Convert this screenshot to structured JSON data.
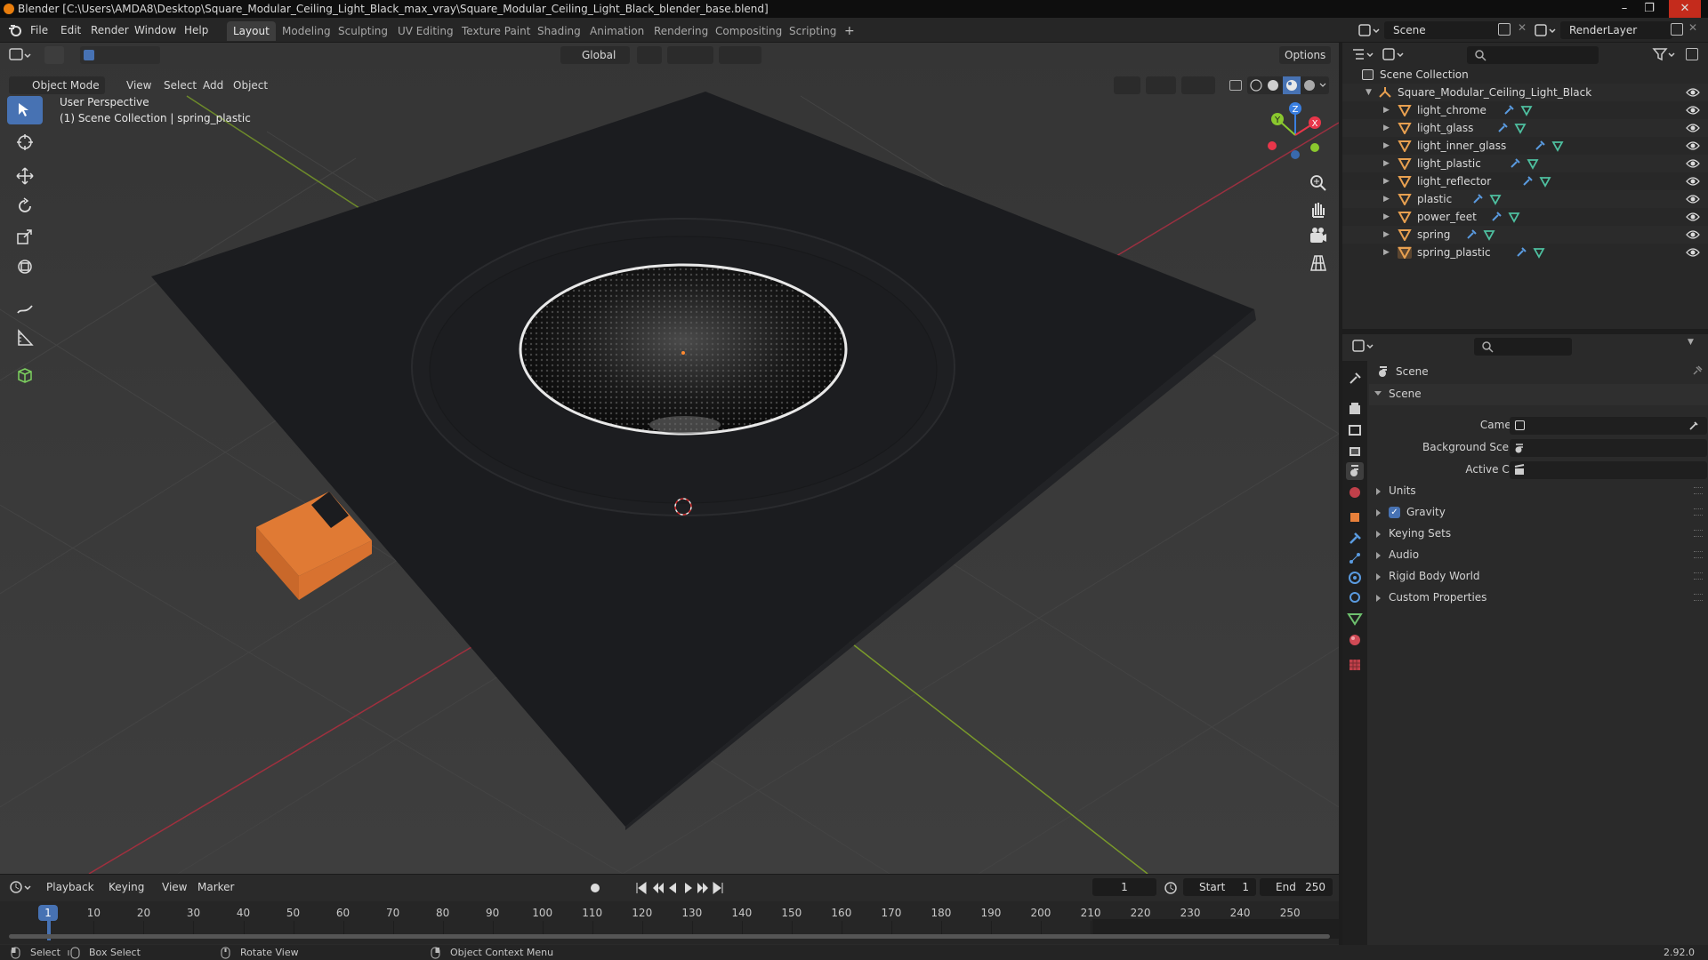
{
  "window": {
    "title": "Blender [C:\\Users\\AMDA8\\Desktop\\Square_Modular_Ceiling_Light_Black_max_vray\\Square_Modular_Ceiling_Light_Black_blender_base.blend]",
    "minimize": "–",
    "maximize": "❐",
    "close": "✕"
  },
  "menu": {
    "file": "File",
    "edit": "Edit",
    "render": "Render",
    "window": "Window",
    "help": "Help"
  },
  "workspaces": [
    "Layout",
    "Modeling",
    "Sculpting",
    "UV Editing",
    "Texture Paint",
    "Shading",
    "Animation",
    "Rendering",
    "Compositing",
    "Scripting"
  ],
  "add_workspace": "+",
  "scene_field": "Scene",
  "render_layer_field": "RenderLayer",
  "viewport": {
    "mode": "Object Mode",
    "menus": {
      "view": "View",
      "select": "Select",
      "add": "Add",
      "object": "Object"
    },
    "orientation": "Global",
    "options": "Options",
    "overlay_line1": "User Perspective",
    "overlay_line2": "(1) Scene Collection | spring_plastic",
    "gizmo": {
      "x": "X",
      "y": "Y",
      "z": "Z"
    }
  },
  "timeline": {
    "menus": {
      "playback": "Playback",
      "keying": "Keying",
      "view": "View",
      "marker": "Marker"
    },
    "current_frame": "1",
    "start_label": "Start",
    "start": "1",
    "end_label": "End",
    "end": "250",
    "ticks": [
      "1",
      "10",
      "20",
      "30",
      "40",
      "50",
      "60",
      "70",
      "80",
      "90",
      "100",
      "110",
      "120",
      "130",
      "140",
      "150",
      "160",
      "170",
      "180",
      "190",
      "200",
      "210",
      "220",
      "230",
      "240",
      "250"
    ]
  },
  "outliner": {
    "root": "Scene Collection",
    "collection": "Square_Modular_Ceiling_Light_Black",
    "objects": [
      "light_chrome",
      "light_glass",
      "light_inner_glass",
      "light_plastic",
      "light_reflector",
      "plastic",
      "power_feet",
      "spring",
      "spring_plastic"
    ],
    "selected": "spring_plastic"
  },
  "properties": {
    "context": "Scene",
    "panel": "Scene",
    "camera_label": "Camera",
    "background_scene_label": "Background Scene",
    "active_clip_label": "Active Clip",
    "subpanels": [
      "Units",
      "Gravity",
      "Keying Sets",
      "Audio",
      "Rigid Body World",
      "Custom Properties"
    ],
    "gravity_checked": true
  },
  "statusbar": {
    "select": "Select",
    "box_select": "Box Select",
    "rotate_view": "Rotate View",
    "context_menu": "Object Context Menu",
    "version": "2.92.0"
  },
  "colors": {
    "accent": "#4772b3",
    "selected_object": "#e8803a",
    "viewport_bg": "#3b3b3b",
    "x_axis": "#e8364a",
    "y_axis": "#8ac82e",
    "z_axis": "#3a7fe0"
  }
}
